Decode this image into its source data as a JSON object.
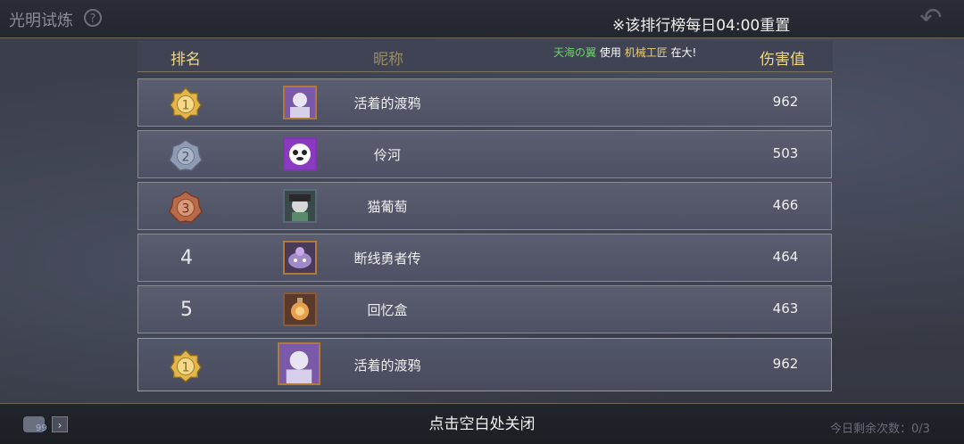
{
  "header": {
    "title": "光明试炼",
    "help_icon": "question-icon",
    "reset_note": "※该排行榜每日04:00重置",
    "back_icon": "back-arrow-icon"
  },
  "table": {
    "col_rank": "排名",
    "col_name": "昵称",
    "col_damage": "伤害值",
    "marquee": {
      "player": "天海の翼",
      "verb": "使用",
      "hero": "机械工匠",
      "suffix": "在大!"
    },
    "rows": [
      {
        "rank": "1",
        "name": "活着的渡鸦",
        "damage": "962",
        "badge": "gold"
      },
      {
        "rank": "2",
        "name": "伶河",
        "damage": "503",
        "badge": "silver"
      },
      {
        "rank": "3",
        "name": "猫葡萄",
        "damage": "466",
        "badge": "bronze"
      },
      {
        "rank": "4",
        "name": "断线勇者传",
        "damage": "464",
        "badge": ""
      },
      {
        "rank": "5",
        "name": "回忆盒",
        "damage": "463",
        "badge": ""
      }
    ],
    "my_row": {
      "rank": "1",
      "name": "活着的渡鸦",
      "damage": "962",
      "badge": "gold"
    }
  },
  "footer": {
    "close_hint": "点击空白处关闭",
    "chat_badge": "99",
    "remaining": "今日剩余次数：0/3"
  },
  "colors": {
    "gold": "#e2b64a",
    "silver": "#8f9bb5",
    "bronze": "#b86a4a",
    "header_text": "#f0d887"
  }
}
